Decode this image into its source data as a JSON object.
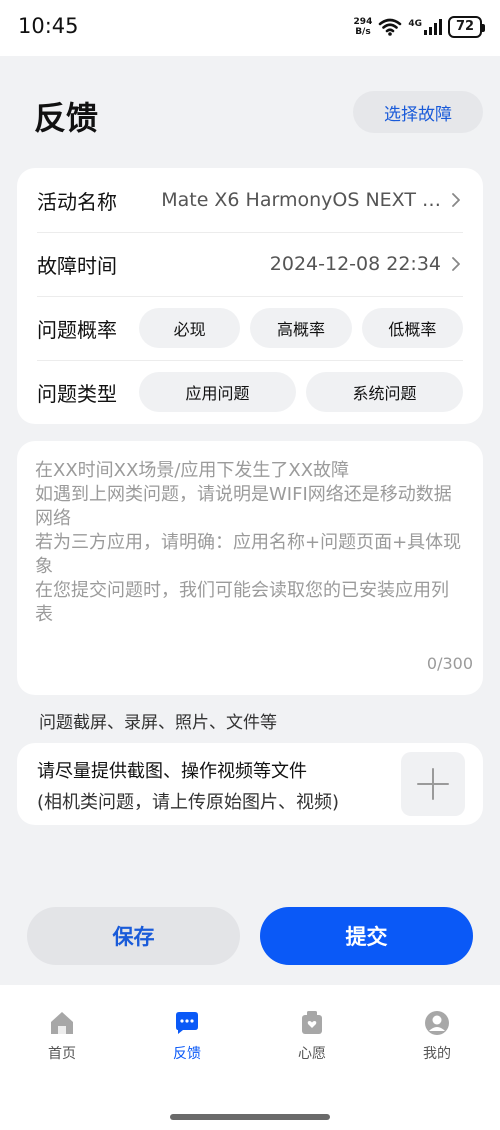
{
  "status_bar": {
    "time": "10:45",
    "net_speed_value": "294",
    "net_speed_unit": "B/s",
    "signal_label": "4G",
    "battery": "72"
  },
  "header": {
    "title": "反馈",
    "fault_button": "选择故障"
  },
  "form": {
    "activity": {
      "label": "活动名称",
      "value": "Mate X6 HarmonyOS NEXT …"
    },
    "fault_time": {
      "label": "故障时间",
      "value": "2024-12-08 22:34"
    },
    "probability": {
      "label": "问题概率",
      "options": [
        "必现",
        "高概率",
        "低概率"
      ]
    },
    "type": {
      "label": "问题类型",
      "options": [
        "应用问题",
        "系统问题"
      ]
    }
  },
  "description": {
    "placeholder": "在XX时间XX场景/应用下发生了XX故障\n如遇到上网类问题，请说明是WIFI网络还是移动数据网络\n若为三方应用，请明确：应用名称+问题页面+具体现象\n在您提交问题时，我们可能会读取您的已安装应用列表",
    "counter": "0/300"
  },
  "attachments": {
    "title": "问题截屏、录屏、照片、文件等",
    "hint_line1": "请尽量提供截图、操作视频等文件",
    "hint_line2": "(相机类问题，请上传原始图片、视频)"
  },
  "actions": {
    "save": "保存",
    "submit": "提交"
  },
  "tabbar": {
    "items": [
      {
        "label": "首页",
        "icon": "home-icon"
      },
      {
        "label": "反馈",
        "icon": "feedback-chat-icon",
        "active": true
      },
      {
        "label": "心愿",
        "icon": "wish-box-icon"
      },
      {
        "label": "我的",
        "icon": "profile-icon"
      }
    ]
  },
  "colors": {
    "accent": "#0a59f7",
    "link": "#1a5bd9",
    "background": "#f1f2f4"
  }
}
